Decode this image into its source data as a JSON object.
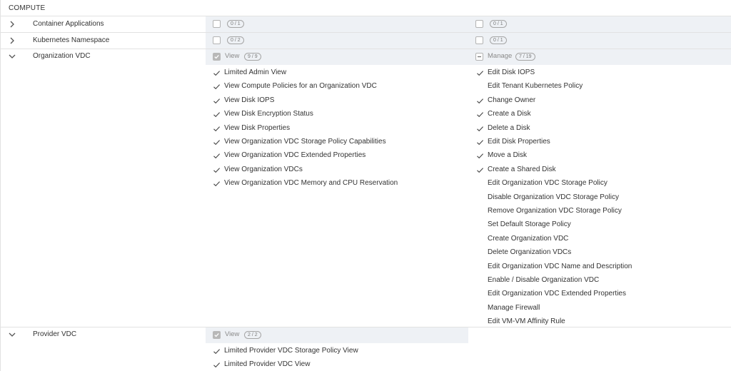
{
  "section_title": "COMPUTE",
  "icons": {
    "expand": "chevron-right-icon",
    "collapse": "chevron-down-icon",
    "granted": "checkmark-icon",
    "all_selected": "checked-checkbox-icon",
    "partial": "indeterminate-checkbox-icon"
  },
  "colors": {
    "header_bg": "#eef1f5",
    "divider": "#e2e2e2",
    "checkbox_checked": "#b8b8b8"
  },
  "categories": [
    {
      "name": "Container Applications",
      "expanded": false,
      "left_count": "0 / 1",
      "right_count": "0 / 1"
    },
    {
      "name": "Kubernetes Namespace",
      "expanded": false,
      "left_count": "0 / 2",
      "right_count": "0 / 1"
    },
    {
      "name": "Organization VDC",
      "expanded": true,
      "view_label": "View",
      "view_count": "9 / 9",
      "manage_label": "Manage",
      "manage_count": "7 / 19",
      "view_items": [
        {
          "label": "Limited Admin View",
          "granted": true
        },
        {
          "label": "View Compute Policies for an Organization VDC",
          "granted": true
        },
        {
          "label": "View Disk IOPS",
          "granted": true
        },
        {
          "label": "View Disk Encryption Status",
          "granted": true
        },
        {
          "label": "View Disk Properties",
          "granted": true
        },
        {
          "label": "View Organization VDC Storage Policy Capabilities",
          "granted": true
        },
        {
          "label": "View Organization VDC Extended Properties",
          "granted": true
        },
        {
          "label": "View Organization VDCs",
          "granted": true
        },
        {
          "label": "View Organization VDC Memory and CPU Reservation",
          "granted": true
        }
      ],
      "manage_items": [
        {
          "label": "Edit Disk IOPS",
          "granted": true
        },
        {
          "label": "Edit Tenant Kubernetes Policy",
          "granted": false
        },
        {
          "label": "Change Owner",
          "granted": true
        },
        {
          "label": "Create a Disk",
          "granted": true
        },
        {
          "label": "Delete a Disk",
          "granted": true
        },
        {
          "label": "Edit Disk Properties",
          "granted": true
        },
        {
          "label": "Move a Disk",
          "granted": true
        },
        {
          "label": "Create a Shared Disk",
          "granted": true
        },
        {
          "label": "Edit Organization VDC Storage Policy",
          "granted": false
        },
        {
          "label": "Disable Organization VDC Storage Policy",
          "granted": false
        },
        {
          "label": "Remove Organization VDC Storage Policy",
          "granted": false
        },
        {
          "label": "Set Default Storage Policy",
          "granted": false
        },
        {
          "label": "Create Organization VDC",
          "granted": false
        },
        {
          "label": "Delete Organization VDCs",
          "granted": false
        },
        {
          "label": "Edit Organization VDC Name and Description",
          "granted": false
        },
        {
          "label": "Enable / Disable Organization VDC",
          "granted": false
        },
        {
          "label": "Edit Organization VDC Extended Properties",
          "granted": false
        },
        {
          "label": "Manage Firewall",
          "granted": false
        },
        {
          "label": "Edit VM-VM Affinity Rule",
          "granted": false
        }
      ]
    },
    {
      "name": "Provider VDC",
      "expanded": true,
      "view_label": "View",
      "view_count": "2 / 2",
      "view_items": [
        {
          "label": "Limited Provider VDC Storage Policy View",
          "granted": true
        },
        {
          "label": "Limited Provider VDC View",
          "granted": true
        }
      ]
    }
  ]
}
